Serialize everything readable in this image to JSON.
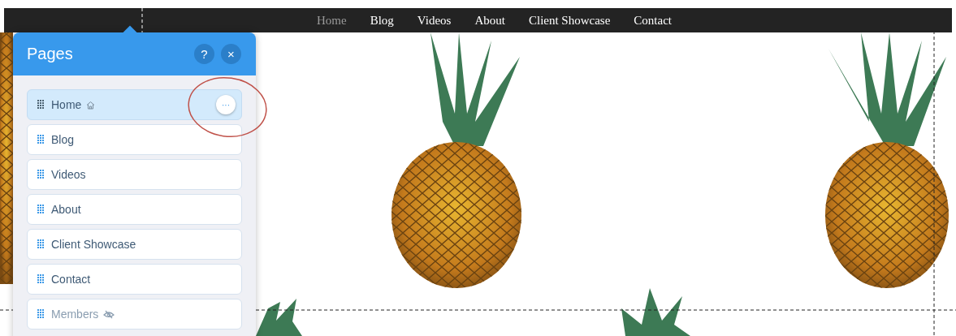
{
  "site_nav": {
    "items": [
      {
        "label": "Home",
        "selected": true
      },
      {
        "label": "Blog",
        "selected": false
      },
      {
        "label": "Videos",
        "selected": false
      },
      {
        "label": "About",
        "selected": false
      },
      {
        "label": "Client Showcase",
        "selected": false
      },
      {
        "label": "Contact",
        "selected": false
      }
    ]
  },
  "pages_panel": {
    "title": "Pages",
    "help": "?",
    "close": "×",
    "more": "···",
    "pages": [
      {
        "label": "Home",
        "kind": "home",
        "selected": true
      },
      {
        "label": "Blog",
        "kind": "page",
        "selected": false
      },
      {
        "label": "Videos",
        "kind": "page",
        "selected": false
      },
      {
        "label": "About",
        "kind": "page",
        "selected": false
      },
      {
        "label": "Client Showcase",
        "kind": "page",
        "selected": false
      },
      {
        "label": "Contact",
        "kind": "page",
        "selected": false
      },
      {
        "label": "Members",
        "kind": "hidden",
        "selected": false
      }
    ]
  }
}
